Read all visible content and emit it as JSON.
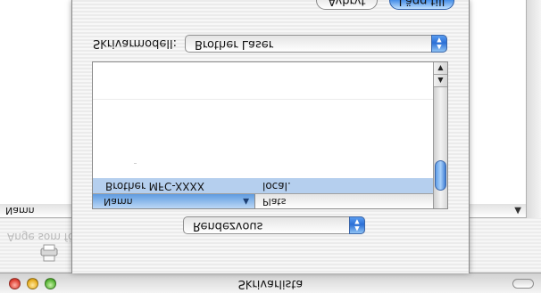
{
  "window": {
    "title": "Skrivarlista"
  },
  "toolbar": {
    "save_as_label": "Ange som för"
  },
  "back_list": {
    "column_name": "Namn"
  },
  "sheet": {
    "model_label": "Skrivarmodell:",
    "model_value": "Brother Laser",
    "connection_value": "Rendezvous",
    "cancel_label": "Avbryt",
    "add_label": "Lägg till",
    "list": {
      "columns": [
        "Namn",
        "Plats"
      ],
      "rows": [
        {
          "name": "Brother MFC-XXXX",
          "location": "local."
        }
      ]
    }
  },
  "colors": {
    "accent": "#3f8ae6",
    "selection": "#b5cfee"
  },
  "icons": {
    "printer": "printer-icon",
    "close": "close-button",
    "minimize": "minimize-button",
    "zoom": "zoom-button"
  }
}
